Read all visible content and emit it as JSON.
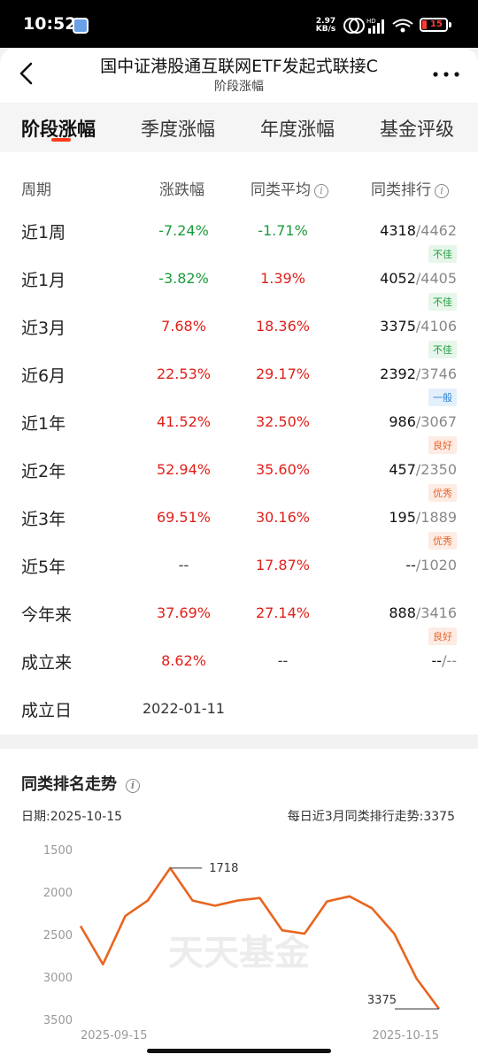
{
  "status": {
    "time": "10:52",
    "speed_value": "2.97",
    "speed_unit": "KB/s",
    "battery": "15"
  },
  "header": {
    "title": "国中证港股通互联网ETF发起式联接C",
    "subtitle": "阶段涨幅"
  },
  "tabs": [
    "阶段涨幅",
    "季度涨幅",
    "年度涨幅",
    "基金评级"
  ],
  "table": {
    "headers": {
      "period": "周期",
      "change": "涨跌幅",
      "avg": "同类平均",
      "rank": "同类排行"
    },
    "rows": [
      {
        "period": "近1周",
        "change": "-7.24%",
        "change_color": "green",
        "avg": "-1.71%",
        "avg_color": "green",
        "rank": "4318",
        "total": "/4462",
        "badge": "不佳",
        "badge_type": "bad"
      },
      {
        "period": "近1月",
        "change": "-3.82%",
        "change_color": "green",
        "avg": "1.39%",
        "avg_color": "red",
        "rank": "4052",
        "total": "/4405",
        "badge": "不佳",
        "badge_type": "bad"
      },
      {
        "period": "近3月",
        "change": "7.68%",
        "change_color": "red",
        "avg": "18.36%",
        "avg_color": "red",
        "rank": "3375",
        "total": "/4106",
        "badge": "不佳",
        "badge_type": "bad"
      },
      {
        "period": "近6月",
        "change": "22.53%",
        "change_color": "red",
        "avg": "29.17%",
        "avg_color": "red",
        "rank": "2392",
        "total": "/3746",
        "badge": "一般",
        "badge_type": "normal"
      },
      {
        "period": "近1年",
        "change": "41.52%",
        "change_color": "red",
        "avg": "32.50%",
        "avg_color": "red",
        "rank": "986",
        "total": "/3067",
        "badge": "良好",
        "badge_type": "good"
      },
      {
        "period": "近2年",
        "change": "52.94%",
        "change_color": "red",
        "avg": "35.60%",
        "avg_color": "red",
        "rank": "457",
        "total": "/2350",
        "badge": "优秀",
        "badge_type": "good"
      },
      {
        "period": "近3年",
        "change": "69.51%",
        "change_color": "red",
        "avg": "30.16%",
        "avg_color": "red",
        "rank": "195",
        "total": "/1889",
        "badge": "优秀",
        "badge_type": "good"
      },
      {
        "period": "近5年",
        "change": "--",
        "change_color": "neutral",
        "avg": "17.87%",
        "avg_color": "red",
        "rank": "--",
        "total": "/1020",
        "badge": "",
        "badge_type": ""
      },
      {
        "period": "今年来",
        "change": "37.69%",
        "change_color": "red",
        "avg": "27.14%",
        "avg_color": "red",
        "rank": "888",
        "total": "/3416",
        "badge": "良好",
        "badge_type": "good"
      },
      {
        "period": "成立来",
        "change": "8.62%",
        "change_color": "red",
        "avg": "--",
        "avg_color": "neutral",
        "rank": "--",
        "total": "/--",
        "badge": "",
        "badge_type": ""
      },
      {
        "period": "成立日",
        "change": "2022-01-11",
        "change_color": "neutral",
        "avg": "",
        "avg_color": "neutral",
        "rank": "",
        "total": "",
        "badge": "",
        "badge_type": ""
      }
    ]
  },
  "badge_colors": {
    "bad": {
      "bg": "#e6f6ea",
      "fg": "#1a9c3a"
    },
    "normal": {
      "bg": "#e3f0fb",
      "fg": "#2a7fd4"
    },
    "good": {
      "bg": "#fdece4",
      "fg": "#e8632c"
    }
  },
  "trend": {
    "title": "同类排名走势",
    "date_label": "日期:2025-10-15",
    "summary": "每日近3月同类排行走势:3375",
    "watermark": "天天基金"
  },
  "chart_data": {
    "type": "line",
    "title": "同类排名走势",
    "y_inverted": true,
    "ylim": [
      1500,
      3500
    ],
    "yticks": [
      1500,
      2000,
      2500,
      3000,
      3500
    ],
    "x_tick_labels": [
      "2025-09-15",
      "2025-10-15"
    ],
    "color": "#e8651f",
    "values": [
      2400,
      2850,
      2280,
      2100,
      1718,
      2100,
      2160,
      2100,
      2070,
      2450,
      2490,
      2110,
      2050,
      2190,
      2490,
      3020,
      3375
    ],
    "annotations": [
      {
        "index": 4,
        "label": "1718"
      },
      {
        "index": 16,
        "label": "3375"
      }
    ]
  }
}
